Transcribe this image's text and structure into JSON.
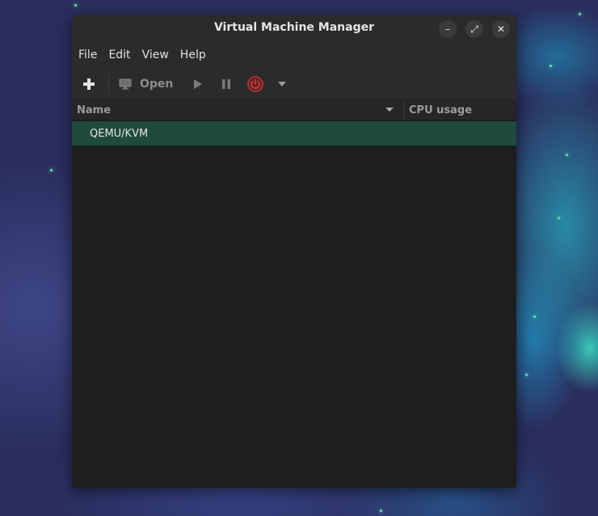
{
  "window": {
    "title": "Virtual Machine Manager",
    "controls": {
      "minimize": "–",
      "maximize": "⤢",
      "close": "✕"
    }
  },
  "menubar": {
    "items": [
      {
        "label": "File"
      },
      {
        "label": "Edit"
      },
      {
        "label": "View"
      },
      {
        "label": "Help"
      }
    ]
  },
  "toolbar": {
    "new_icon": "plus-icon",
    "open_label": "Open",
    "open_icon": "monitor-icon",
    "run_icon": "play-icon",
    "pause_icon": "pause-icon",
    "shutdown_icon": "power-icon",
    "shutdown_menu_icon": "chevron-down-icon",
    "shutdown_color": "#c83232"
  },
  "list": {
    "columns": [
      {
        "label": "Name"
      },
      {
        "label": "CPU usage"
      }
    ],
    "rows": [
      {
        "name": "QEMU/KVM",
        "selected": true
      }
    ],
    "selection_color": "#1f4a3e"
  }
}
